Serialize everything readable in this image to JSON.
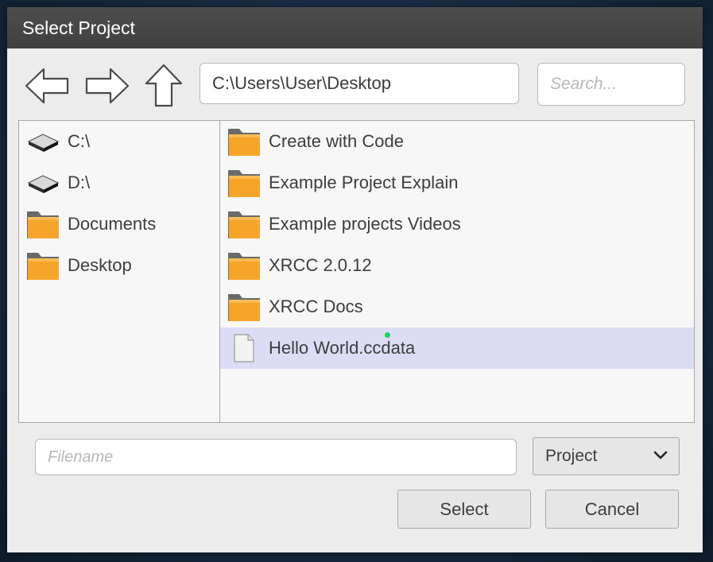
{
  "window": {
    "title": "Select Project"
  },
  "nav": {
    "back_icon": "arrow-left-icon",
    "forward_icon": "arrow-right-icon",
    "up_icon": "arrow-up-icon"
  },
  "path": {
    "value": "C:\\Users\\User\\Desktop"
  },
  "search": {
    "placeholder": "Search..."
  },
  "sidebar": {
    "items": [
      {
        "label": "C:\\",
        "icon": "drive-icon"
      },
      {
        "label": "D:\\",
        "icon": "drive-icon"
      },
      {
        "label": "Documents",
        "icon": "folder-icon"
      },
      {
        "label": "Desktop",
        "icon": "folder-icon"
      }
    ]
  },
  "files": {
    "items": [
      {
        "label": "Create with Code",
        "icon": "folder-icon"
      },
      {
        "label": "Example Project Explain",
        "icon": "folder-icon"
      },
      {
        "label": "Example projects Videos",
        "icon": "folder-icon"
      },
      {
        "label": "XRCC 2.0.12",
        "icon": "folder-icon"
      },
      {
        "label": "XRCC Docs",
        "icon": "folder-icon"
      },
      {
        "label": "Hello World.ccdata",
        "icon": "file-icon",
        "selected": true
      }
    ]
  },
  "footer": {
    "filename_placeholder": "Filename",
    "type_value": "Project",
    "select_label": "Select",
    "cancel_label": "Cancel"
  },
  "colors": {
    "titlebar": "#474747",
    "selection": "#dcdcf5",
    "folder": "#f4a128",
    "cursor": "#19d65a"
  }
}
